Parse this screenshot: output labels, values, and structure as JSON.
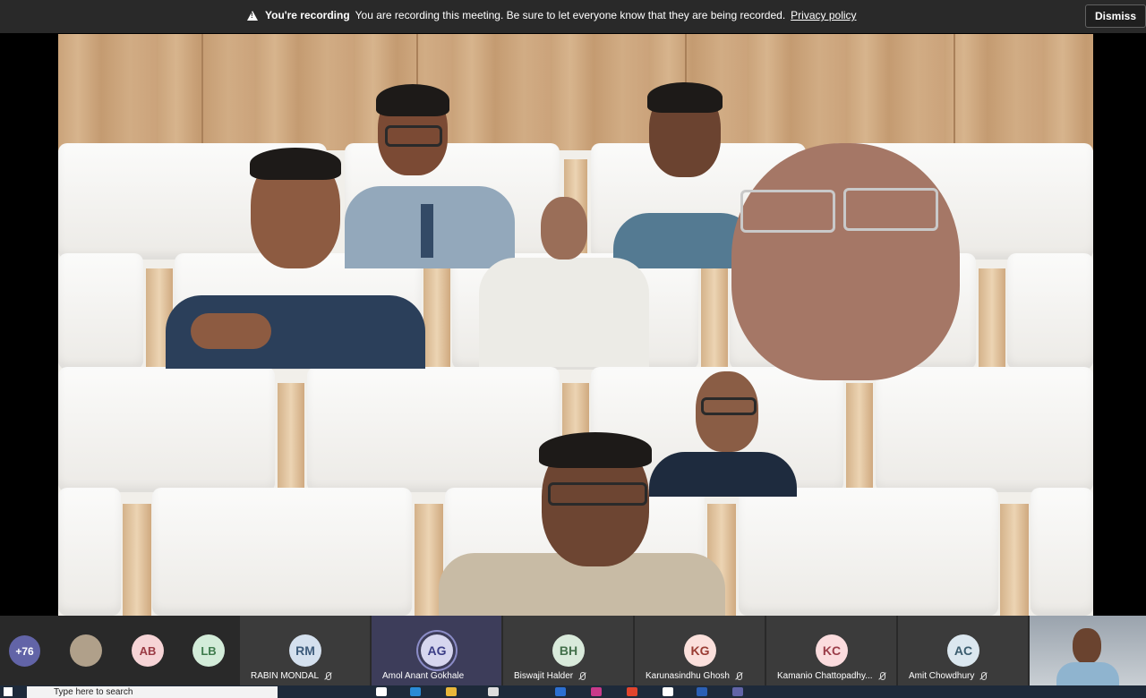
{
  "banner": {
    "title": "You're recording",
    "message": "You are recording this meeting. Be sure to let everyone know that they are being recorded.",
    "link": "Privacy policy",
    "dismiss": "Dismiss"
  },
  "participants_bar": {
    "more_count": "+76",
    "mini_avatars": [
      {
        "initials": "",
        "bg": "#b0a08a",
        "color": "#333"
      },
      {
        "initials": "AB",
        "bg": "#f6d4d6",
        "color": "#9a3a44"
      },
      {
        "initials": "LB",
        "bg": "#d3ecd9",
        "color": "#3e7b4c"
      }
    ],
    "tiles": [
      {
        "initials": "RM",
        "name": "RABIN MONDAL",
        "bg": "#d4e0ee",
        "color": "#3e5c7c",
        "active": false
      },
      {
        "initials": "AG",
        "name": "Amol Anant Gokhale",
        "bg": "#d6d6ef",
        "color": "#3b3d86",
        "active": true
      },
      {
        "initials": "BH",
        "name": "Biswajit Halder",
        "bg": "#d9eadb",
        "color": "#43704b",
        "active": false
      },
      {
        "initials": "KG",
        "name": "Karunasindhu Ghosh",
        "bg": "#fbe0dc",
        "color": "#9a3d34",
        "active": false
      },
      {
        "initials": "KC",
        "name": "Kamanio Chattopadhy...",
        "bg": "#fbdcde",
        "color": "#9b3d49",
        "active": false
      },
      {
        "initials": "AC",
        "name": "Amit Chowdhury",
        "bg": "#dbe7ef",
        "color": "#3a5c6e",
        "active": false
      }
    ]
  },
  "taskbar": {
    "search_placeholder": "Type here to search"
  },
  "colors": {
    "banner_bg": "#292929",
    "bar_bg": "#292929",
    "accent": "#6264a7"
  }
}
